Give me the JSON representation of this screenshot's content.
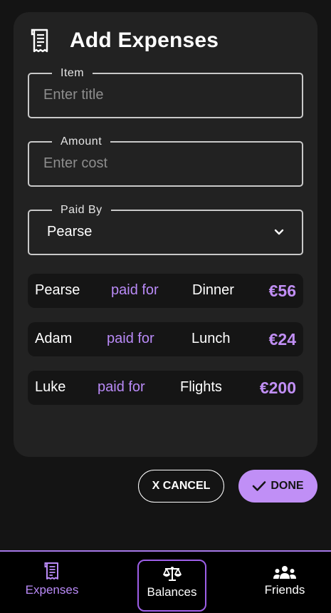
{
  "header": {
    "title": "Add Expenses",
    "icon": "receipt-icon"
  },
  "form": {
    "item": {
      "label": "Item",
      "placeholder": "Enter title",
      "value": ""
    },
    "amount": {
      "label": "Amount",
      "placeholder": "Enter cost",
      "value": ""
    },
    "paid_by": {
      "label": "Paid By",
      "selected": "Pearse"
    }
  },
  "expenses": [
    {
      "who": "Pearse",
      "verb": "paid for",
      "what": "Dinner",
      "amount": "€56"
    },
    {
      "who": "Adam",
      "verb": "paid for",
      "what": "Lunch",
      "amount": "€24"
    },
    {
      "who": "Luke",
      "verb": "paid for",
      "what": "Flights",
      "amount": "€200"
    }
  ],
  "actions": {
    "cancel_label": "X CANCEL",
    "done_label": "DONE"
  },
  "nav": {
    "items": [
      {
        "label": "Expenses",
        "icon": "receipt-icon",
        "active": true
      },
      {
        "label": "Balances",
        "icon": "scale-icon",
        "focused": true
      },
      {
        "label": "Friends",
        "icon": "group-icon"
      }
    ]
  },
  "colors": {
    "accent": "#c08ff6",
    "background": "#141414",
    "card": "#222222",
    "row": "#151515"
  }
}
